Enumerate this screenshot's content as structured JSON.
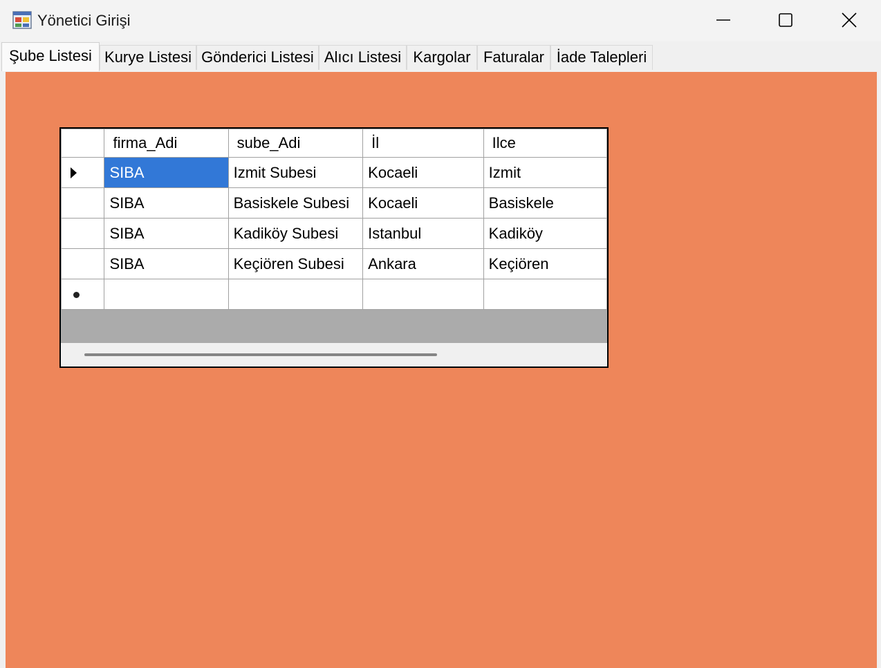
{
  "window": {
    "title": "Yönetici Girişi",
    "icon": "app-form-icon"
  },
  "controls": {
    "minimize_icon": "minimize-icon",
    "maximize_icon": "maximize-icon",
    "close_icon": "close-icon"
  },
  "tabs": [
    {
      "label": "Şube Listesi",
      "active": true
    },
    {
      "label": "Kurye Listesi"
    },
    {
      "label": "Gönderici Listesi"
    },
    {
      "label": "Alıcı Listesi"
    },
    {
      "label": "Kargolar"
    },
    {
      "label": "Faturalar"
    },
    {
      "label": "İade Talepleri"
    }
  ],
  "colors": {
    "tabpage_background": "#ee865a",
    "selected_cell": "#3278d7"
  },
  "grid": {
    "columns": [
      "firma_Adi",
      "sube_Adi",
      "İl",
      "Ilce"
    ],
    "rows": [
      [
        "SIBA",
        "Izmit Subesi",
        "Kocaeli",
        "Izmit"
      ],
      [
        "SIBA",
        "Basiskele Subesi",
        "Kocaeli",
        "Basiskele"
      ],
      [
        "SIBA",
        "Kadiköy Subesi",
        "Istanbul",
        "Kadiköy"
      ],
      [
        "SIBA",
        "Keçiören Subesi",
        "Ankara",
        "Keçiören"
      ]
    ],
    "current_row_indicator": "current-row-arrow-icon",
    "new_row_indicator": "new-row-asterisk-icon"
  }
}
